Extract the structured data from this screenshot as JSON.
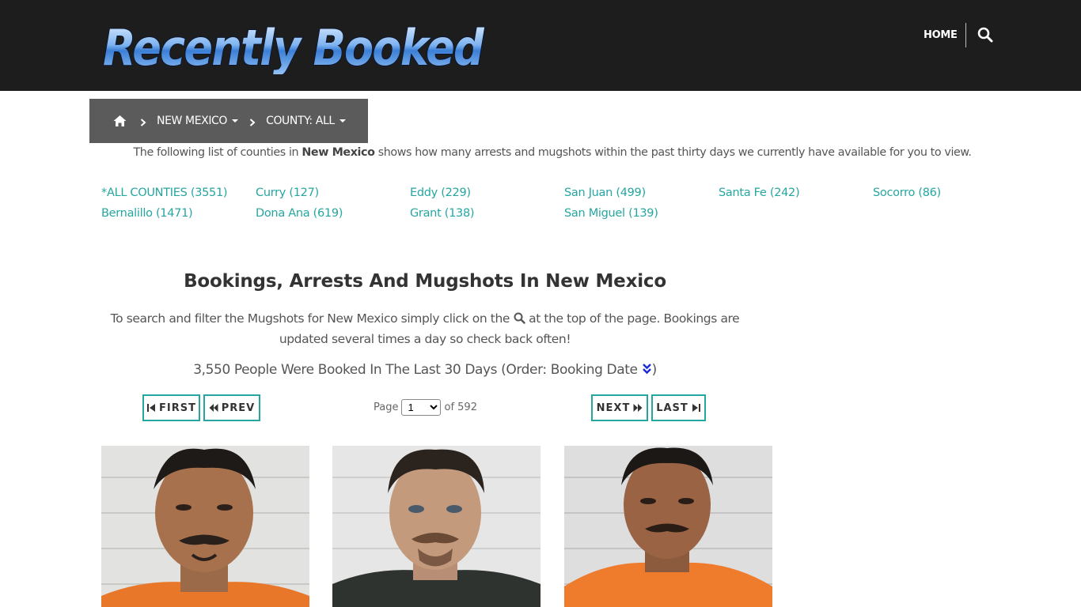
{
  "header": {
    "logo_text": "Recently Booked",
    "nav_home": "HOME"
  },
  "breadcrumb": {
    "state": "NEW MEXICO",
    "county": "COUNTY: ALL"
  },
  "intro": {
    "prefix": "The following list of counties in ",
    "state": "New Mexico",
    "suffix": " shows how many arrests and mugshots within the past thirty days we currently have available for you to view."
  },
  "counties": [
    "*ALL COUNTIES (3551)",
    "Bernalillo (1471)",
    "Curry (127)",
    "Dona Ana (619)",
    "Eddy (229)",
    "Grant (138)",
    "San Juan (499)",
    "San Miguel (139)",
    "Santa Fe (242)",
    "Socorro (86)"
  ],
  "main": {
    "title": "Bookings, Arrests And Mugshots In New Mexico",
    "desc_before": "To search and filter the Mugshots for New Mexico simply click on the ",
    "desc_after": " at the top of the page. Bookings are updated several times a day so check back often!",
    "count_text": "3,550 People Were Booked In The Last 30 Days (Order: Booking Date ",
    "count_close": ")"
  },
  "pagination": {
    "first": "FIRST",
    "prev": "PREV",
    "next": "NEXT",
    "last": "LAST",
    "page_label": "Page",
    "current_page": "1",
    "of_label": "of 592"
  },
  "colors": {
    "header_bg": "#1d1d1d",
    "accent": "#26a6a0",
    "breadcrumb_bg": "#5b5b5b"
  },
  "icons": [
    "home-icon",
    "search-icon",
    "chevron-right-icon",
    "caret-down-icon",
    "double-chevron-down-icon",
    "step-backward-icon",
    "backward-icon",
    "forward-icon",
    "step-forward-icon"
  ]
}
